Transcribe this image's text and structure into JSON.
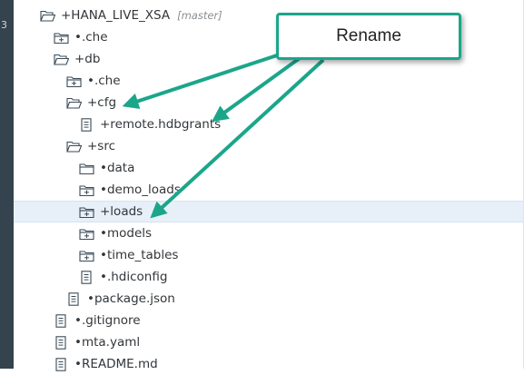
{
  "sidebar": {
    "glyph": "3"
  },
  "callout": {
    "label": "Rename"
  },
  "tree": {
    "root": {
      "label": "+HANA_LIVE_XSA",
      "branch": "[master]"
    },
    "items": [
      {
        "label": "•.che",
        "icon": "folder-collapsed-icon"
      },
      {
        "label": "+db",
        "icon": "folder-open-icon"
      },
      {
        "label": "•.che",
        "icon": "folder-collapsed-icon"
      },
      {
        "label": "+cfg",
        "icon": "folder-open-icon"
      },
      {
        "label": "+remote.hdbgrants",
        "icon": "file-icon"
      },
      {
        "label": "+src",
        "icon": "folder-open-icon"
      },
      {
        "label": "•data",
        "icon": "folder-icon"
      },
      {
        "label": "•demo_loads",
        "icon": "folder-collapsed-icon"
      },
      {
        "label": "+loads",
        "icon": "folder-collapsed-icon"
      },
      {
        "label": "•models",
        "icon": "folder-collapsed-icon"
      },
      {
        "label": "•time_tables",
        "icon": "folder-collapsed-icon"
      },
      {
        "label": "•.hdiconfig",
        "icon": "file-icon"
      },
      {
        "label": "•package.json",
        "icon": "file-icon"
      },
      {
        "label": "•.gitignore",
        "icon": "file-icon"
      },
      {
        "label": "•mta.yaml",
        "icon": "file-icon"
      },
      {
        "label": "•README.md",
        "icon": "file-icon"
      }
    ]
  },
  "colors": {
    "accent": "#1ba68a",
    "icon": "#3b4a56",
    "selection": "#e7f0f8"
  }
}
